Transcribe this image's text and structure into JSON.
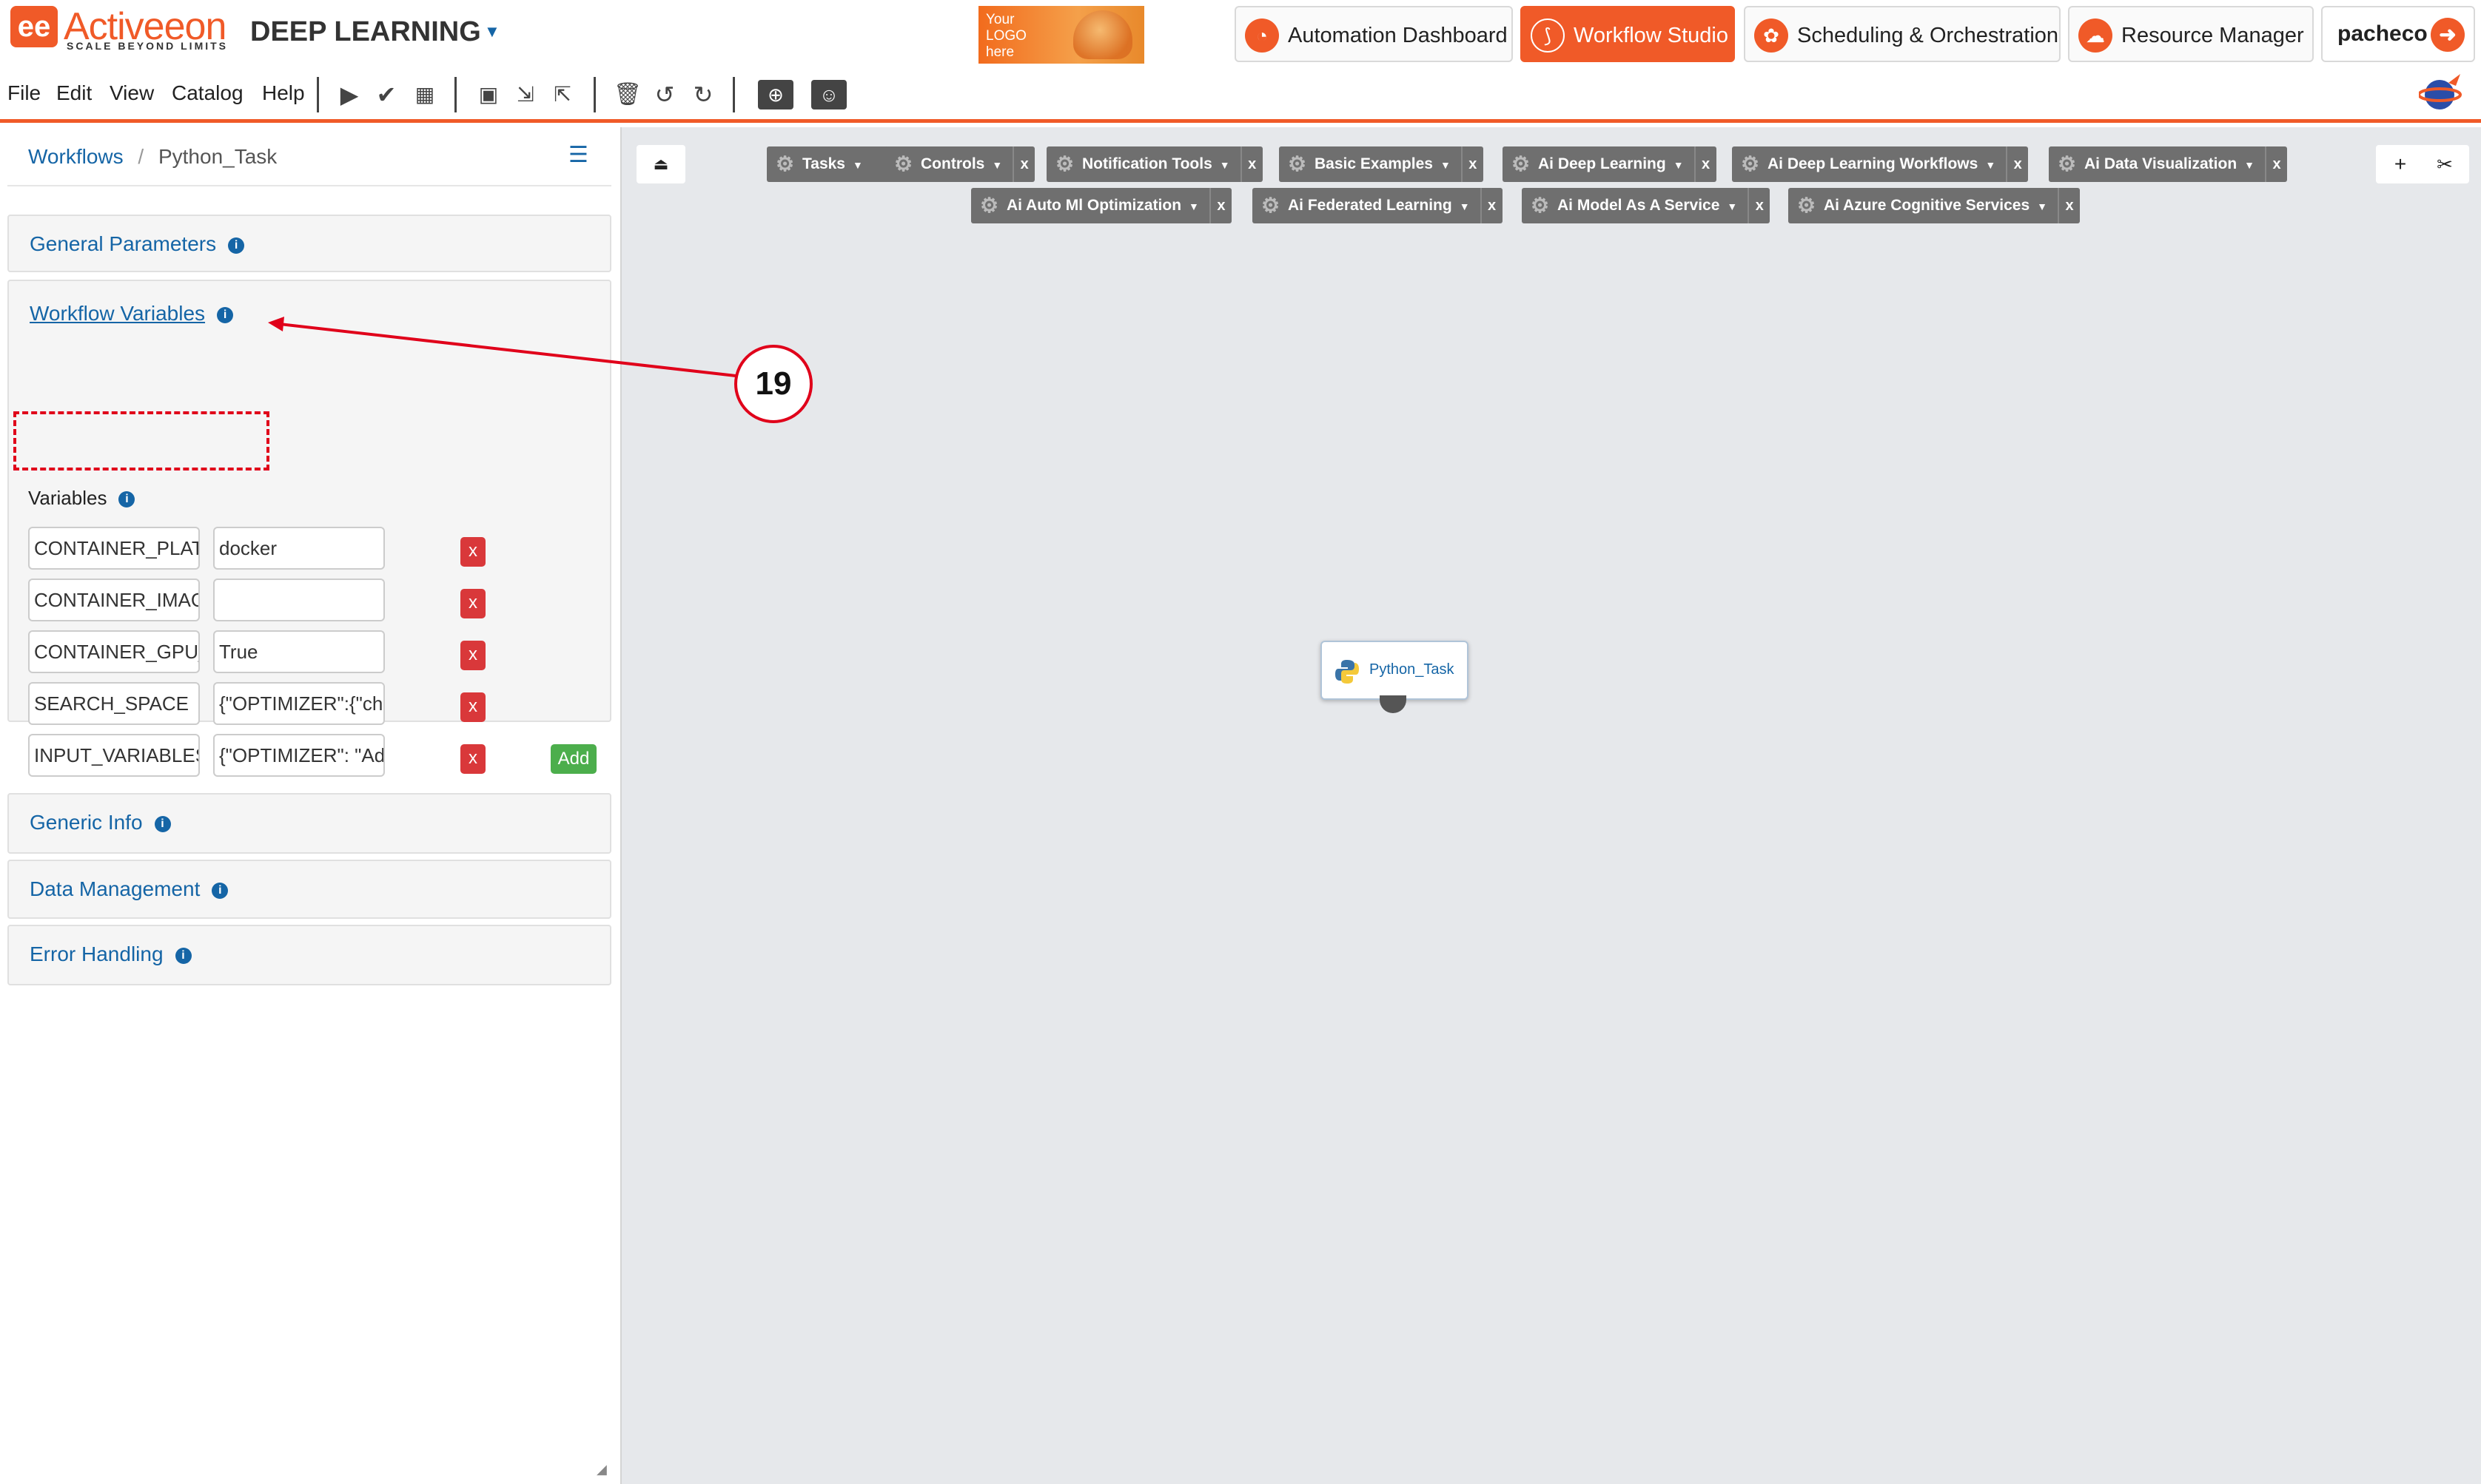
{
  "header": {
    "brand_name": "Activeeon",
    "brand_tagline": "SCALE BEYOND LIMITS",
    "project_title": "DEEP LEARNING",
    "logo_placeholder": "Your LOGO here",
    "apps": [
      {
        "label": "Automation Dashboard",
        "icon": "gauge-icon",
        "active": false
      },
      {
        "label": "Workflow Studio",
        "icon": "workflow-icon",
        "active": true
      },
      {
        "label": "Scheduling & Orchestration",
        "icon": "gears-icon",
        "active": false
      },
      {
        "label": "Resource Manager",
        "icon": "cloud-icon",
        "active": false
      }
    ],
    "user": "pacheco",
    "brand_color": "#f05a28"
  },
  "menu": {
    "items": [
      "File",
      "Edit",
      "View",
      "Catalog",
      "Help"
    ]
  },
  "toolbar": {
    "icons": [
      "play-icon",
      "check-icon",
      "calendar-icon",
      "save-icon",
      "import-icon",
      "export-icon",
      "trash-icon",
      "undo-icon",
      "redo-icon",
      "global-folder-icon",
      "user-folder-icon"
    ]
  },
  "sidebar": {
    "breadcrumb_root": "Workflows",
    "breadcrumb_current": "Python_Task",
    "sections": {
      "general": "General Parameters",
      "workflow_variables": "Workflow Variables",
      "generic_info": "Generic Info",
      "data_management": "Data Management",
      "error_handling": "Error Handling"
    },
    "variables_label": "Variables",
    "variables": [
      {
        "name": "CONTAINER_PLATFORM",
        "value": "docker"
      },
      {
        "name": "CONTAINER_IMAGE",
        "value": ""
      },
      {
        "name": "CONTAINER_GPU_ENABLED",
        "value": "True"
      },
      {
        "name": "SEARCH_SPACE",
        "value": "{\"OPTIMIZER\":{\"choice\""
      },
      {
        "name": "INPUT_VARIABLES",
        "value": "{\"OPTIMIZER\": \"Adam\""
      }
    ],
    "delete_label": "x",
    "add_label": "Add"
  },
  "canvas": {
    "buckets_row1": [
      "Tasks",
      "Controls",
      "Notification Tools",
      "Basic Examples",
      "Ai Deep Learning",
      "Ai Deep Learning Workflows",
      "Ai Data Visualization"
    ],
    "buckets_row2": [
      "Ai Auto Ml Optimization",
      "Ai Federated Learning",
      "Ai Model As A Service",
      "Ai Azure Cognitive Services"
    ],
    "task_label": "Python_Task",
    "zoom_in": "+",
    "close_x": "x"
  },
  "annotation": {
    "number": "19",
    "color": "#e0001a"
  }
}
